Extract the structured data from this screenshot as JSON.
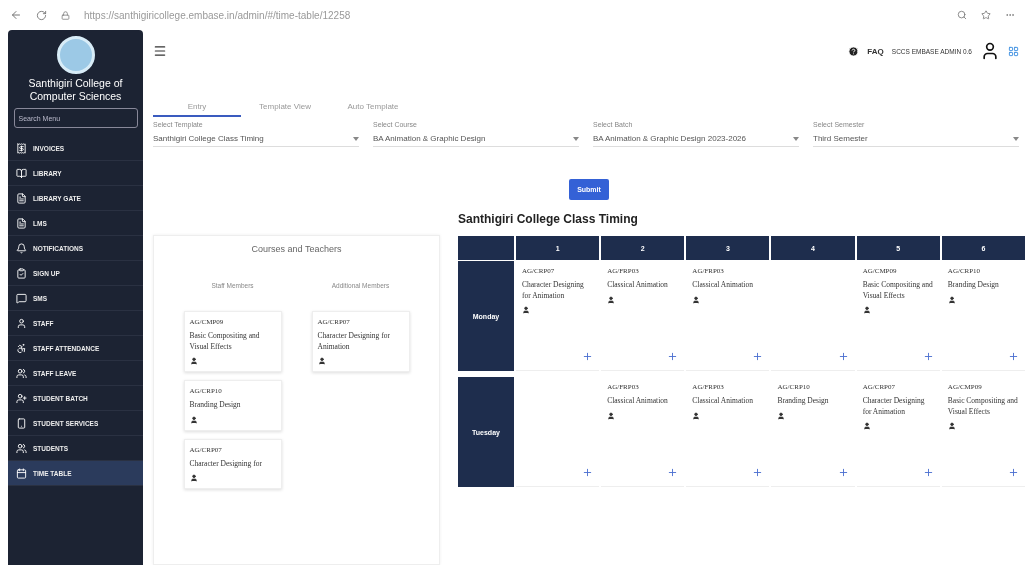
{
  "browser": {
    "url": "https://santhigiricollege.embase.in/admin/#/time-table/12258"
  },
  "sidebar": {
    "title": "Santhigiri College of Computer Sciences",
    "search": {
      "placeholder": "Search Menu"
    },
    "items": [
      {
        "label": "INVOICES",
        "selected": false
      },
      {
        "label": "LIBRARY",
        "selected": false
      },
      {
        "label": "LIBRARY GATE",
        "selected": false
      },
      {
        "label": "LMS",
        "selected": false
      },
      {
        "label": "NOTIFICATIONS",
        "selected": false
      },
      {
        "label": "SIGN UP",
        "selected": false
      },
      {
        "label": "SMS",
        "selected": false
      },
      {
        "label": "STAFF",
        "selected": false
      },
      {
        "label": "STAFF ATTENDANCE",
        "selected": false
      },
      {
        "label": "STAFF LEAVE",
        "selected": false
      },
      {
        "label": "STUDENT BATCH",
        "selected": false
      },
      {
        "label": "STUDENT SERVICES",
        "selected": false
      },
      {
        "label": "STUDENTS",
        "selected": false
      },
      {
        "label": "TIME TABLE",
        "selected": true
      }
    ]
  },
  "header": {
    "faq": "FAQ",
    "user": "SCCS EMBASE ADMIN 0.6"
  },
  "tabs": [
    {
      "label": "Entry",
      "selected": true
    },
    {
      "label": "Template View",
      "selected": false
    },
    {
      "label": "Auto Template",
      "selected": false
    }
  ],
  "fields": [
    {
      "label": "Select Template",
      "value": "Santhigiri College Class Timing"
    },
    {
      "label": "Select Course",
      "value": "BA Animation & Graphic Design"
    },
    {
      "label": "Select Batch",
      "value": "BA Animation & Graphic Design 2023-2026"
    },
    {
      "label": "Select Semester",
      "value": "Third Semester"
    }
  ],
  "submit": "Submit",
  "timetable_title": "Santhigiri College Class Timing",
  "courses_panel": {
    "title": "Courses and Teachers",
    "columns": [
      {
        "heading": "Staff Members",
        "cards": [
          {
            "code": "AG/CMP09",
            "name": "Basic Compositing and Visual Effects"
          },
          {
            "code": "AG/CRP10",
            "name": "Branding Design"
          },
          {
            "code": "AG/CRP07",
            "name": "Character Designing for"
          }
        ]
      },
      {
        "heading": "Additional Members",
        "cards": [
          {
            "code": "AG/CRP07",
            "name": "Character Designing for Animation"
          }
        ]
      }
    ]
  },
  "table": {
    "periods": [
      "1",
      "2",
      "3",
      "4",
      "5",
      "6"
    ],
    "rows": [
      {
        "day": "Monday",
        "cells": [
          {
            "code": "AG/CRP07",
            "name": "Character Designing for Animation"
          },
          {
            "code": "AG/FRP03",
            "name": "Classical Animation"
          },
          {
            "code": "AG/FRP03",
            "name": "Classical Animation"
          },
          {},
          {
            "code": "AG/CMP09",
            "name": "Basic Compositing and Visual Effects"
          },
          {
            "code": "AG/CRP10",
            "name": "Branding Design"
          }
        ]
      },
      {
        "day": "Tuesday",
        "cells": [
          {},
          {
            "code": "AG/FRP03",
            "name": "Classical Animation"
          },
          {
            "code": "AG/FRP03",
            "name": "Classical Animation"
          },
          {
            "code": "AG/CRP10",
            "name": "Branding Design"
          },
          {
            "code": "AG/CRP07",
            "name": "Character Designing for Animation"
          },
          {
            "code": "AG/CMP09",
            "name": "Basic Compositing and Visual Effects"
          }
        ]
      }
    ]
  }
}
